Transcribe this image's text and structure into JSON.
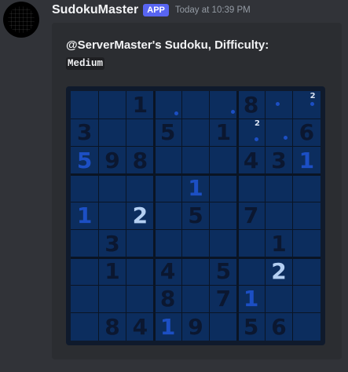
{
  "message": {
    "author": "SudokuMaster",
    "badge": "APP",
    "timestamp": "Today at 10:39 PM"
  },
  "embed": {
    "title_prefix": "@ServerMaster's Sudoku, Difficulty:",
    "difficulty": "Medium"
  },
  "sudoku": {
    "grid": [
      [
        "",
        "",
        "1",
        "",
        "",
        "",
        "8",
        "",
        ""
      ],
      [
        "3",
        "",
        "",
        "5",
        "",
        "1",
        "",
        "",
        "6"
      ],
      [
        "5",
        "9",
        "8",
        "",
        "",
        "",
        "4",
        "3",
        "1"
      ],
      [
        "",
        "",
        "",
        "",
        "1",
        "",
        "",
        "",
        ""
      ],
      [
        "1",
        "",
        "2",
        "",
        "5",
        "",
        "7",
        "",
        ""
      ],
      [
        "",
        "3",
        "",
        "",
        "",
        "",
        "",
        "1",
        ""
      ],
      [
        "",
        "1",
        "",
        "4",
        "",
        "5",
        "",
        "2",
        ""
      ],
      [
        "",
        "",
        "",
        "8",
        "",
        "7",
        "1",
        "",
        ""
      ],
      [
        "",
        "8",
        "4",
        "1",
        "9",
        "",
        "5",
        "6",
        ""
      ]
    ],
    "styles": [
      [
        "",
        "",
        "",
        "",
        "",
        "",
        "",
        "",
        ""
      ],
      [
        "",
        "",
        "",
        "",
        "",
        "",
        "",
        "",
        ""
      ],
      [
        "blue",
        "",
        "",
        "",
        "",
        "",
        "",
        "",
        "blue"
      ],
      [
        "",
        "",
        "",
        "",
        "blue",
        "",
        "",
        "",
        ""
      ],
      [
        "blue",
        "",
        "light",
        "",
        "",
        "",
        "",
        "",
        ""
      ],
      [
        "",
        "",
        "",
        "",
        "",
        "",
        "",
        "",
        ""
      ],
      [
        "",
        "",
        "",
        "",
        "",
        "",
        "",
        "light",
        ""
      ],
      [
        "",
        "",
        "",
        "",
        "",
        "",
        "blue",
        "",
        ""
      ],
      [
        "",
        "",
        "",
        "blue",
        "",
        "",
        "",
        "",
        ""
      ]
    ],
    "notes": [
      {
        "row": 0,
        "col": 8,
        "digit": "2"
      },
      {
        "row": 1,
        "col": 6,
        "digit": "2"
      }
    ],
    "colors": {
      "given": "#0b1730",
      "user": "#1c4fc4",
      "highlight": "#b4cff2",
      "cell_bg": "#0c2d5e"
    }
  }
}
